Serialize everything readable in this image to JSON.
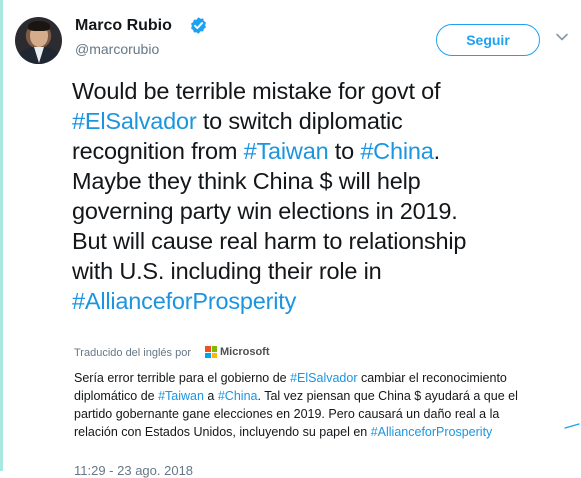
{
  "user": {
    "name": "Marco Rubio",
    "handle": "@marcorubio"
  },
  "follow_button": {
    "label": "Seguir"
  },
  "tweet": {
    "lines": [
      [
        {
          "t": "Would be terrible mistake for govt of",
          "tag": false
        }
      ],
      [
        {
          "t": "#ElSalvador",
          "tag": true
        },
        {
          "t": " to switch diplomatic",
          "tag": false
        }
      ],
      [
        {
          "t": "recognition from ",
          "tag": false
        },
        {
          "t": "#Taiwan",
          "tag": true
        },
        {
          "t": " to ",
          "tag": false
        },
        {
          "t": "#China",
          "tag": true
        },
        {
          "t": ".",
          "tag": false
        }
      ],
      [
        {
          "t": "Maybe they think China $ will help",
          "tag": false
        }
      ],
      [
        {
          "t": "governing party win elections in 2019.",
          "tag": false
        }
      ],
      [
        {
          "t": "But will cause real harm to relationship",
          "tag": false
        }
      ],
      [
        {
          "t": "with U.S. including their role in",
          "tag": false
        }
      ],
      [
        {
          "t": "#AllianceforProsperity",
          "tag": true
        }
      ]
    ]
  },
  "translation": {
    "label": "Traducido del inglés por",
    "provider": "Microsoft",
    "lines": [
      [
        {
          "t": "Sería error terrible para el gobierno de ",
          "tag": false
        },
        {
          "t": "#ElSalvador",
          "tag": true
        },
        {
          "t": " cambiar el reconocimiento",
          "tag": false
        }
      ],
      [
        {
          "t": "diplomático de ",
          "tag": false
        },
        {
          "t": "#Taiwan",
          "tag": true
        },
        {
          "t": " a ",
          "tag": false
        },
        {
          "t": "#China",
          "tag": true
        },
        {
          "t": ". Tal vez piensan que China $ ayudará a que el",
          "tag": false
        }
      ],
      [
        {
          "t": "partido gobernante gane elecciones en 2019. Pero causará un daño real a la",
          "tag": false
        }
      ],
      [
        {
          "t": "relación con Estados Unidos, incluyendo su papel en ",
          "tag": false
        },
        {
          "t": "#AllianceforProsperity",
          "tag": true
        }
      ]
    ]
  },
  "timestamp": "11:29 - 23 ago. 2018",
  "colors": {
    "accent": "#1da1f2",
    "hashtag": "#1b95e0",
    "verified": "#1da1f2",
    "thread_rule": "#a9e8e0",
    "ms_red": "#f25022",
    "ms_green": "#7fba00",
    "ms_blue": "#00a4ef",
    "ms_yellow": "#ffb900"
  },
  "icons": [
    "verified-badge-icon",
    "chevron-down-icon",
    "microsoft-logo-icon"
  ]
}
